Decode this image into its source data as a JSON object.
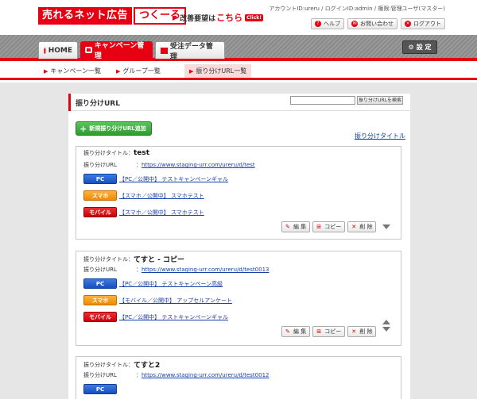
{
  "header": {
    "logo_part1": "売れるネット広告",
    "logo_part2": "つくーる",
    "improve_text": "改善要望は",
    "improve_here": "こちら",
    "improve_click": "Click!",
    "account_info": "アカウントID:ureru / ログインID:admin / 権限:管理ユーザ(マスター)",
    "help_label": "ヘルプ",
    "contact_label": "お問い合わせ",
    "logout_label": "ログアウト"
  },
  "nav": {
    "tabs": [
      {
        "label": "HOME"
      },
      {
        "label": "キャンペーン管理"
      },
      {
        "label": "受注データ管理"
      }
    ],
    "settings_label": "設 定"
  },
  "subnav": {
    "items": [
      {
        "label": "キャンペーン一覧"
      },
      {
        "label": "グループ一覧"
      },
      {
        "label": "振り分けURL一覧"
      }
    ]
  },
  "panel": {
    "title": "振り分けURL",
    "search_value": "",
    "search_button": "振り分けURLを検索",
    "add_button": "新規振り分けURL追加",
    "title_link": "振り分けタイトル"
  },
  "labels": {
    "title": "振り分けタイトル：",
    "url": "振り分けURL",
    "url_sep": "：",
    "edit": "編 集",
    "copy": "コピー",
    "delete": "削 除"
  },
  "cards": [
    {
      "name": "test",
      "url": "https://www.staging-urr.com/ureru/d/test",
      "devices": [
        {
          "chip": "PC",
          "link": "【PC／公開中】 テストキャンペーンギャル"
        },
        {
          "chip": "スマホ",
          "link": "【スマホ／公開中】 スマホテスト"
        },
        {
          "chip": "モバイル",
          "link": "【スマホ／公開中】 スマホテスト"
        }
      ]
    },
    {
      "name": "てすと - コピー",
      "url": "https://www.staging-urr.com/ureru/d/test0013",
      "devices": [
        {
          "chip": "PC",
          "link": "【PC／公開中】 テストキャンペーン高級"
        },
        {
          "chip": "スマホ",
          "link": "【モバイル／公開中】 アップセルアンケート"
        },
        {
          "chip": "モバイル",
          "link": "【PC／公開中】 テストキャンペーンギャル"
        }
      ]
    },
    {
      "name": "てすと2",
      "url": "https://www.staging-urr.com/ureru/d/test0012",
      "devices": [
        {
          "chip": "PC",
          "link": ""
        }
      ]
    }
  ],
  "colors": {
    "brand_red": "#e60012",
    "pc_blue": "#1450c0",
    "smartphone_orange": "#ef8a00",
    "mobile_red": "#c8000a",
    "add_green": "#2e9b2e"
  }
}
